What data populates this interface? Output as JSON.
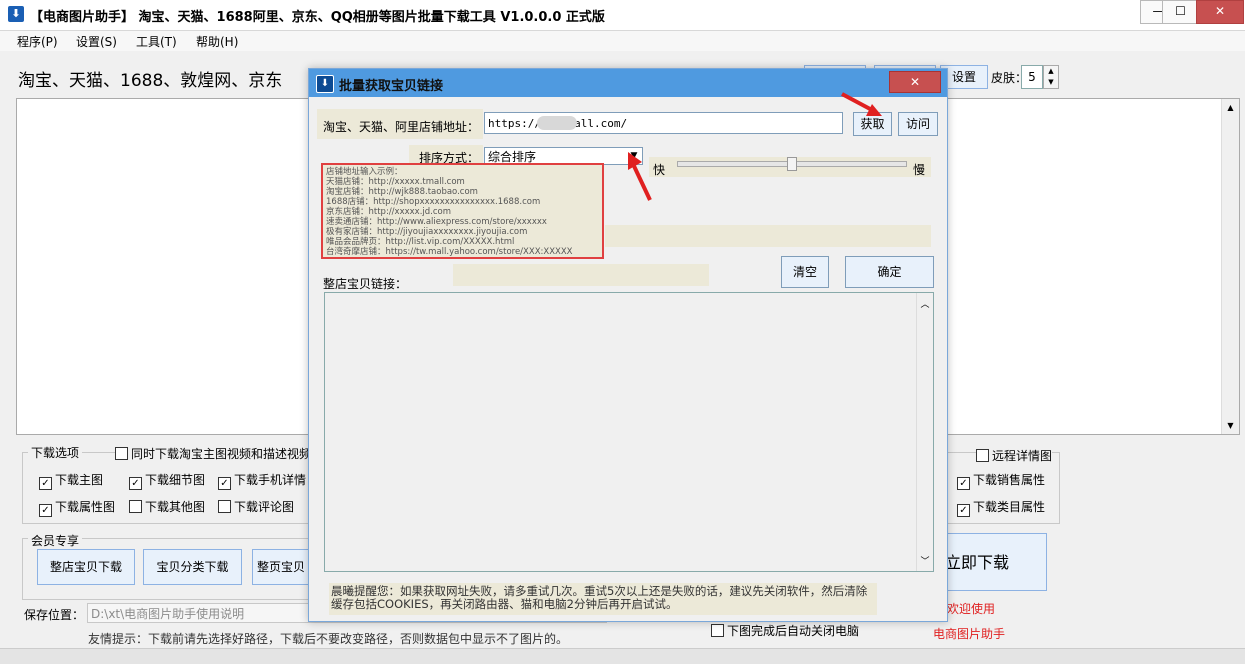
{
  "window": {
    "title": "【电商图片助手】 淘宝、天猫、1688阿里、京东、QQ相册等图片批量下载工具 V1.0.0.0 正式版",
    "minimize_label": "—",
    "maximize_label": "☐",
    "close_label": "✕"
  },
  "menu": [
    "程序(P)",
    "设置(S)",
    "工具(T)",
    "帮助(H)"
  ],
  "banner": {
    "text": "淘宝、天猫、1688、敦煌网、京东",
    "settings_label": "设置",
    "skin_label": "皮肤：",
    "skin_value": "5"
  },
  "options": {
    "group_label": "下载选项",
    "video_check": {
      "label": "同时下载淘宝主图视频和描述视频",
      "checked": false
    },
    "row1": [
      {
        "label": "下载主图",
        "checked": true
      },
      {
        "label": "下载细节图",
        "checked": true
      },
      {
        "label": "下载手机详情",
        "checked": true
      }
    ],
    "row2": [
      {
        "label": "下载属性图",
        "checked": true
      },
      {
        "label": "下载其他图",
        "checked": false
      },
      {
        "label": "下载评论图",
        "checked": false
      }
    ],
    "right": [
      {
        "label": "远程详情图",
        "checked": false
      },
      {
        "label": "下载销售属性",
        "checked": true
      },
      {
        "label": "下载类目属性",
        "checked": true
      }
    ]
  },
  "member": {
    "group_label": "会员专享",
    "buttons": [
      "整店宝贝下载",
      "宝贝分类下载",
      "整页宝贝"
    ],
    "download_now": "立即下载",
    "welcome": "欢迎使用",
    "brand": "电商图片助手"
  },
  "save": {
    "label": "保存位置：",
    "path": "D:\\xt\\电商图片助手使用说明",
    "tip": "友情提示：下载前请先选择好路径，下载后不要改变路径，否则数据包中显示不了图片的。",
    "auto_close": "下图完成后自动关闭电脑"
  },
  "dialog": {
    "title": "批量获取宝贝链接",
    "close_label": "✕",
    "url_label": "淘宝、天猫、阿里店铺地址：",
    "url_value": "https://j       .tmall.com/",
    "get_label": "获取",
    "visit_label": "访问",
    "sort_label": "排序方式：",
    "sort_value": "综合排序",
    "fast_label": "快",
    "slow_label": "慢",
    "speed_level": 0.5,
    "examples": [
      "店铺地址输入示例：",
      "天猫店铺：http://xxxxx.tmall.com",
      "淘宝店铺：http://wjk888.taobao.com",
      "1688店铺：http://shopxxxxxxxxxxxxxxx.1688.com",
      "京东店铺：http://xxxxx.jd.com",
      "速卖通店铺：http://www.aliexpress.com/store/xxxxxx",
      "极有家店铺：http://jiyoujiaxxxxxxxx.jiyoujia.com",
      "唯品会品牌页：http://list.vip.com/XXXXX.html",
      "台湾奇摩店铺：https://tw.mall.yahoo.com/store/XXX:XXXXX"
    ],
    "clear_label": "清空",
    "ok_label": "确定",
    "links_label": "整店宝贝链接：",
    "notice": "晨曦提醒您：如果获取网址失败，请多重试几次。重试5次以上还是失败的话，建议先关闭软件，然后清除缓存包括COOKIES，再关闭路由器、猫和电脑2分钟后再开启试试。"
  },
  "colors": {
    "dialog_title_bg": "#4f9ae0",
    "close_red": "#c75050",
    "highlight_red": "#e04040",
    "button_bg": "#e8f1fb",
    "beige": "#ece9d8"
  }
}
